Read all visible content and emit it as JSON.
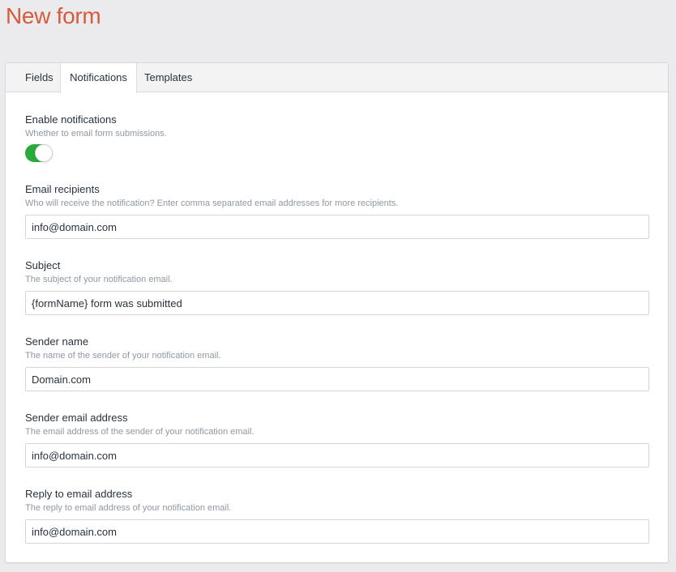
{
  "page": {
    "title": "New form"
  },
  "tabs": [
    {
      "label": "Fields",
      "active": false
    },
    {
      "label": "Notifications",
      "active": true
    },
    {
      "label": "Templates",
      "active": false
    }
  ],
  "notifications": {
    "enable": {
      "label": "Enable notifications",
      "help": "Whether to email form submissions.",
      "enabled": true
    },
    "recipients": {
      "label": "Email recipients",
      "help": "Who will receive the notification? Enter comma separated email addresses for more recipients.",
      "value": "info@domain.com"
    },
    "subject": {
      "label": "Subject",
      "help": "The subject of your notification email.",
      "value": "{formName} form was submitted"
    },
    "sender_name": {
      "label": "Sender name",
      "help": "The name of the sender of your notification email.",
      "value": "Domain.com"
    },
    "sender_email": {
      "label": "Sender email address",
      "help": "The email address of the sender of your notification email.",
      "value": "info@domain.com"
    },
    "reply_to": {
      "label": "Reply to email address",
      "help": "The reply to email address of your notification email.",
      "value": "info@domain.com"
    }
  },
  "colors": {
    "title": "#d65b3e",
    "toggle_on": "#27ab3b",
    "background": "#ebebed"
  }
}
